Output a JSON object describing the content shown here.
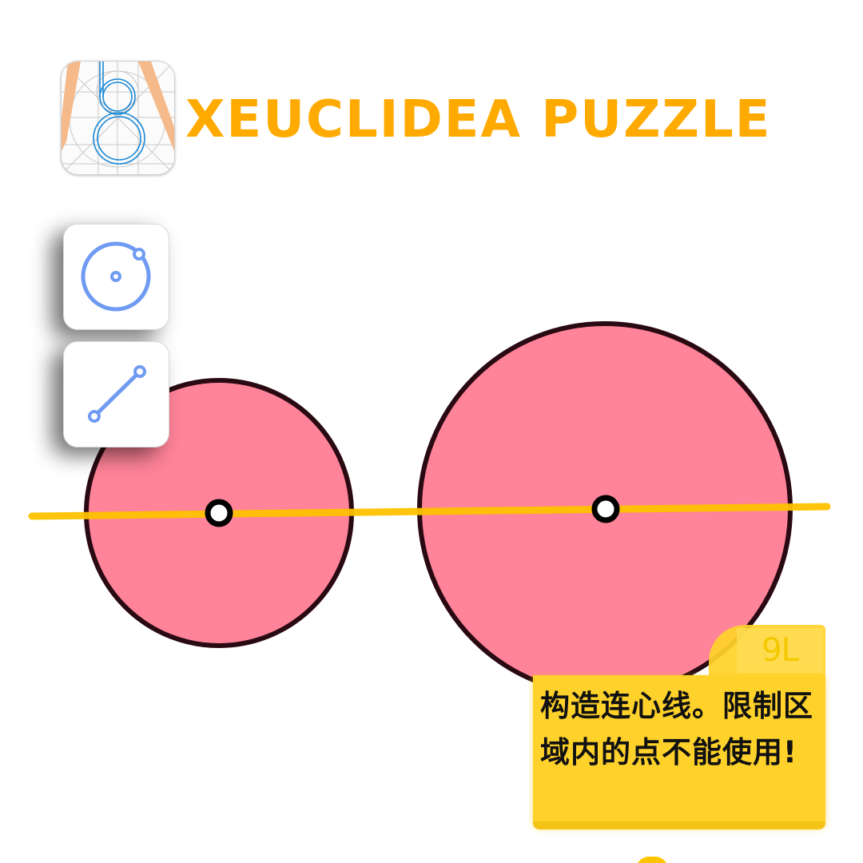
{
  "header": {
    "logo_icon": "euclidea-app-icon",
    "title": "XEUCLIDEA PUZZLE",
    "title_color": "#ffaa00"
  },
  "tools": [
    {
      "id": "circle",
      "icon": "circle-tool-icon"
    },
    {
      "id": "line",
      "icon": "line-tool-icon"
    }
  ],
  "board": {
    "circle_fill": "#ff8399",
    "circle_stroke": "#2a0a12",
    "line_color": "#ffc200",
    "point_stroke": "#000000"
  },
  "goal": {
    "level": "9L",
    "text": "构造连心线。限制区域内的点不能使用!",
    "card_color": "#ffd22b"
  }
}
